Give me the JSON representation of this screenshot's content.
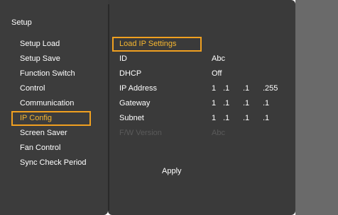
{
  "left": {
    "title": "Setup",
    "items": [
      {
        "label": "Setup Load"
      },
      {
        "label": "Setup Save"
      },
      {
        "label": "Function Switch"
      },
      {
        "label": "Control"
      },
      {
        "label": "Communication"
      },
      {
        "label": "IP Config"
      },
      {
        "label": "Screen Saver"
      },
      {
        "label": "Fan Control"
      },
      {
        "label": "Sync Check Period"
      }
    ]
  },
  "main": {
    "load_label": "Load IP Settings",
    "id": {
      "label": "ID",
      "value": "Abc"
    },
    "dhcp": {
      "label": "DHCP",
      "value": "Off"
    },
    "ip": {
      "label": "IP Address",
      "octets": [
        "1",
        ".1",
        ".1",
        ".255"
      ]
    },
    "gateway": {
      "label": "Gateway",
      "octets": [
        "1",
        ".1",
        ".1",
        ".1"
      ]
    },
    "subnet": {
      "label": "Subnet",
      "octets": [
        "1",
        ".1",
        ".1",
        ".1"
      ]
    },
    "fw": {
      "label": "F/W Version",
      "value": "Abc"
    },
    "apply_label": "Apply"
  },
  "colors": {
    "accent": "#f0a020",
    "panel": "#3a3a3a",
    "right_bg": "#6a6a6a"
  }
}
